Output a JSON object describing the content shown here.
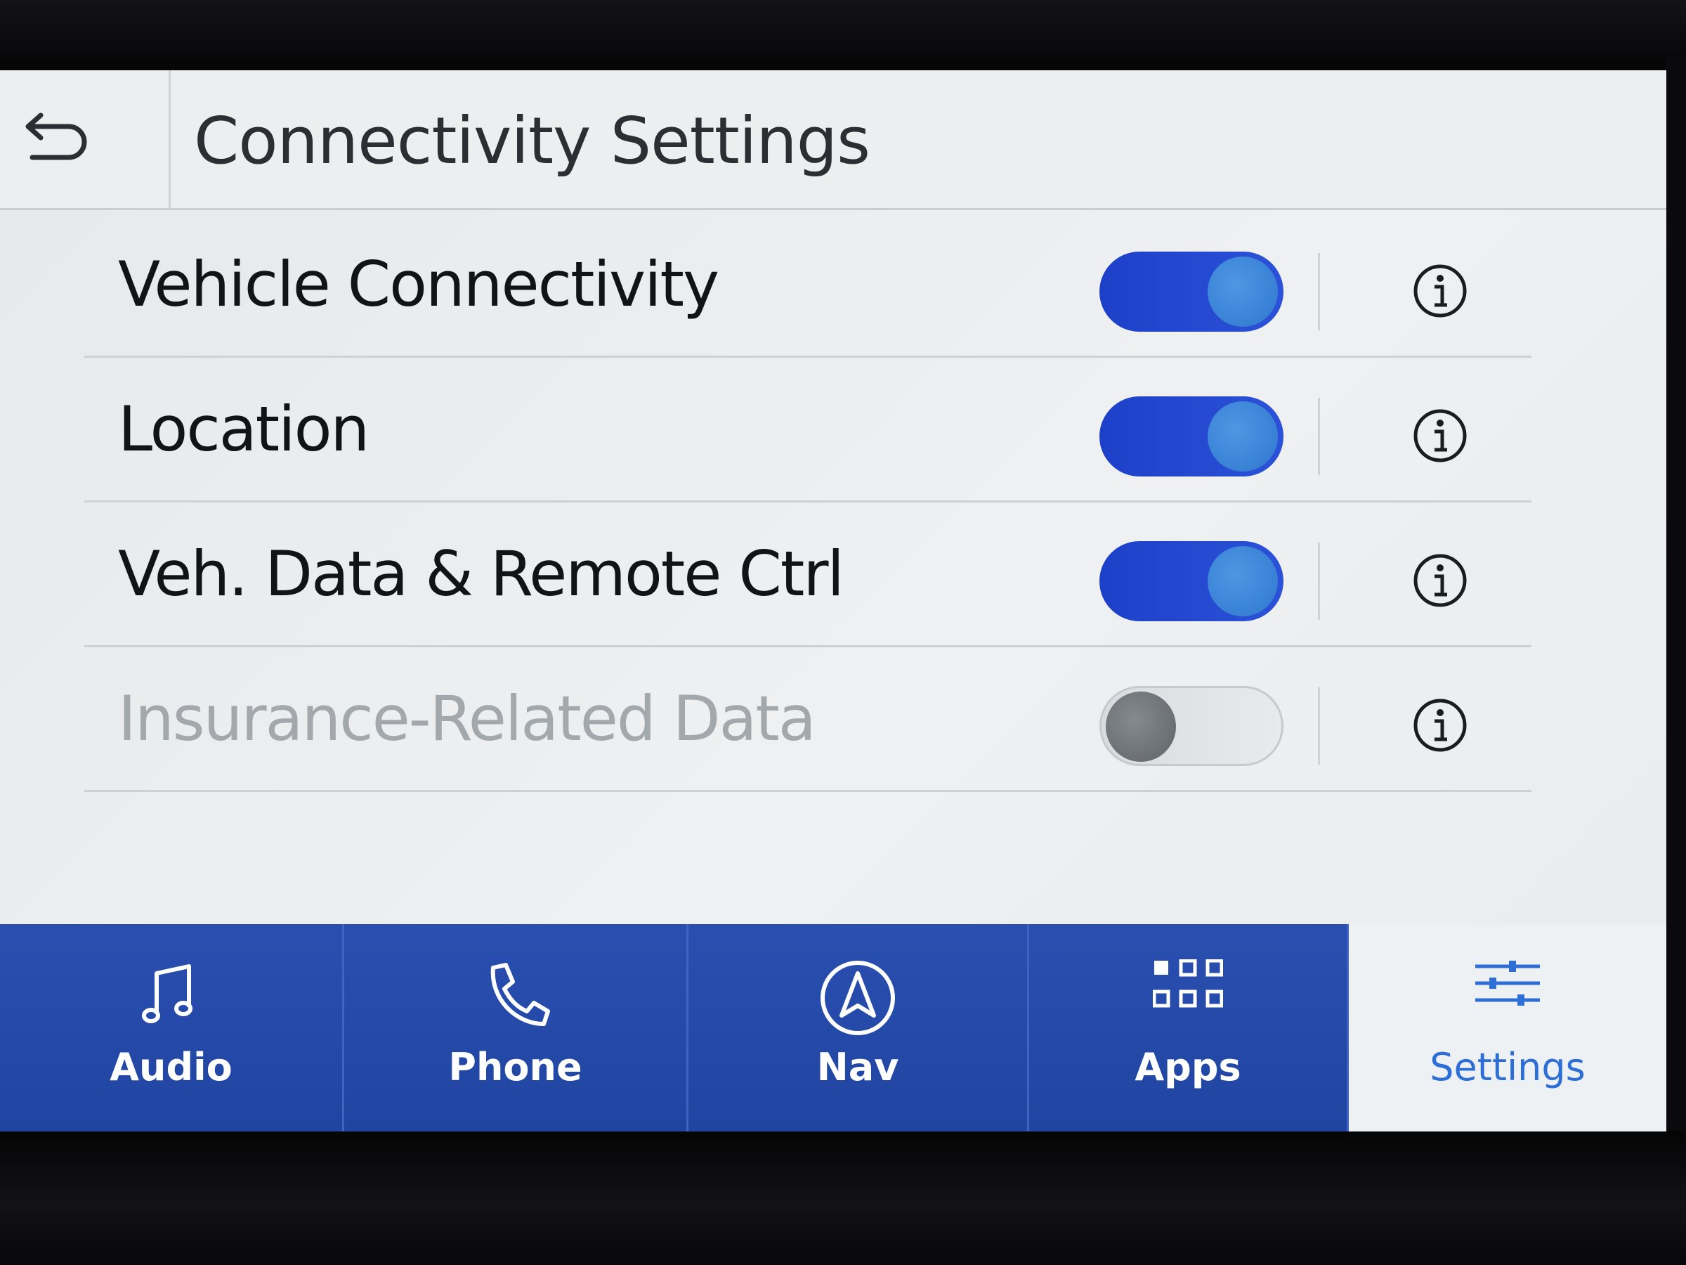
{
  "header": {
    "title": "Connectivity Settings",
    "back_icon": "back-arrow-icon"
  },
  "settings": [
    {
      "label": "Vehicle Connectivity",
      "enabled": true,
      "active": true
    },
    {
      "label": "Location",
      "enabled": true,
      "active": true
    },
    {
      "label": "Veh. Data & Remote Ctrl",
      "enabled": true,
      "active": true
    },
    {
      "label": "Insurance-Related Data",
      "enabled": false,
      "active": false
    }
  ],
  "nav": {
    "items": [
      {
        "label": "Audio",
        "icon": "music-note-icon"
      },
      {
        "label": "Phone",
        "icon": "phone-icon"
      },
      {
        "label": "Nav",
        "icon": "navigation-icon"
      },
      {
        "label": "Apps",
        "icon": "apps-grid-icon"
      },
      {
        "label": "Settings",
        "icon": "sliders-icon",
        "selected": true
      }
    ]
  },
  "colors": {
    "toggle_on": "#2449cf",
    "knob_on": "#3a86d9",
    "nav_bar": "#2447a8",
    "active_accent": "#2d6fd6"
  }
}
